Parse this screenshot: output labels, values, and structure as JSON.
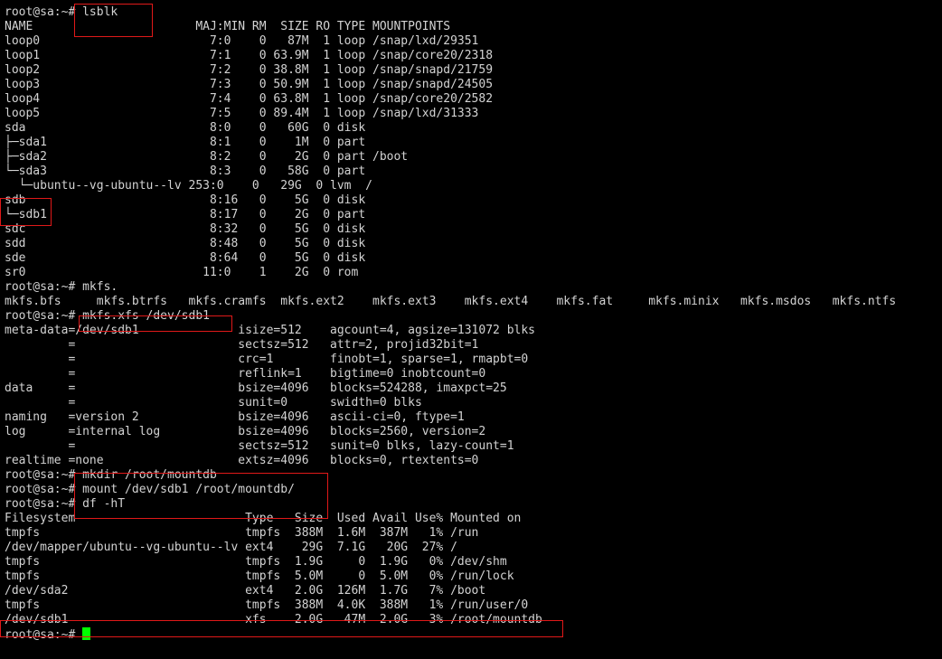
{
  "terminal": {
    "lines": [
      "root@sa:~# lsblk",
      "NAME                       MAJ:MIN RM  SIZE RO TYPE MOUNTPOINTS",
      "loop0                        7:0    0   87M  1 loop /snap/lxd/29351",
      "loop1                        7:1    0 63.9M  1 loop /snap/core20/2318",
      "loop2                        7:2    0 38.8M  1 loop /snap/snapd/21759",
      "loop3                        7:3    0 50.9M  1 loop /snap/snapd/24505",
      "loop4                        7:4    0 63.8M  1 loop /snap/core20/2582",
      "loop5                        7:5    0 89.4M  1 loop /snap/lxd/31333",
      "sda                          8:0    0   60G  0 disk",
      "├─sda1                       8:1    0    1M  0 part",
      "├─sda2                       8:2    0    2G  0 part /boot",
      "└─sda3                       8:3    0   58G  0 part",
      "  └─ubuntu--vg-ubuntu--lv 253:0    0   29G  0 lvm  /",
      "sdb                          8:16   0    5G  0 disk",
      "└─sdb1                       8:17   0    2G  0 part",
      "sdc                          8:32   0    5G  0 disk",
      "sdd                          8:48   0    5G  0 disk",
      "sde                          8:64   0    5G  0 disk",
      "sr0                         11:0    1    2G  0 rom",
      "root@sa:~# mkfs.",
      "mkfs.bfs     mkfs.btrfs   mkfs.cramfs  mkfs.ext2    mkfs.ext3    mkfs.ext4    mkfs.fat     mkfs.minix   mkfs.msdos   mkfs.ntfs",
      "root@sa:~# mkfs.xfs /dev/sdb1",
      "meta-data=/dev/sdb1              isize=512    agcount=4, agsize=131072 blks",
      "         =                       sectsz=512   attr=2, projid32bit=1",
      "         =                       crc=1        finobt=1, sparse=1, rmapbt=0",
      "         =                       reflink=1    bigtime=0 inobtcount=0",
      "data     =                       bsize=4096   blocks=524288, imaxpct=25",
      "         =                       sunit=0      swidth=0 blks",
      "naming   =version 2              bsize=4096   ascii-ci=0, ftype=1",
      "log      =internal log           bsize=4096   blocks=2560, version=2",
      "         =                       sectsz=512   sunit=0 blks, lazy-count=1",
      "realtime =none                   extsz=4096   blocks=0, rtextents=0",
      "root@sa:~# mkdir /root/mountdb",
      "root@sa:~# mount /dev/sdb1 /root/mountdb/",
      "root@sa:~# df -hT",
      "Filesystem                        Type   Size  Used Avail Use% Mounted on",
      "tmpfs                             tmpfs  388M  1.6M  387M   1% /run",
      "/dev/mapper/ubuntu--vg-ubuntu--lv ext4    29G  7.1G   20G  27% /",
      "tmpfs                             tmpfs  1.9G     0  1.9G   0% /dev/shm",
      "tmpfs                             tmpfs  5.0M     0  5.0M   0% /run/lock",
      "/dev/sda2                         ext4   2.0G  126M  1.7G   7% /boot",
      "tmpfs                             tmpfs  388M  4.0K  388M   1% /run/user/0",
      "/dev/sdb1                         xfs    2.0G   47M  2.0G   3% /root/mountdb"
    ],
    "prompt": "root@sa:~# ",
    "colors": {
      "background": "#000000",
      "text": "#d3d3d3",
      "cursor": "#00ff00",
      "highlight": "#e01919"
    }
  }
}
